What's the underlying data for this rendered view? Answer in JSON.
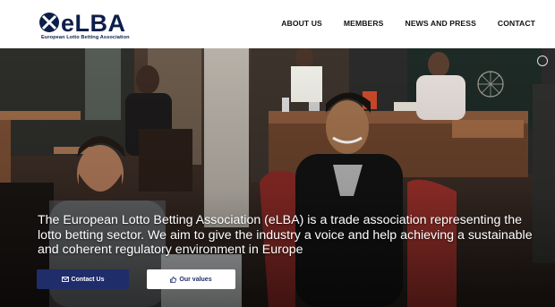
{
  "logo": {
    "name": "eLBA",
    "tagline": "European Lotto Betting Association"
  },
  "nav": {
    "items": [
      "ABOUT US",
      "MEMBERS",
      "NEWS AND PRESS",
      "CONTACT"
    ]
  },
  "hero": {
    "text": "The European Lotto Betting Association (eLBA) is a trade association representing the lotto betting sector. We aim to give the industry a voice and help achieving a sustainable and coherent regulatory environment in Europe",
    "buttons": {
      "contact_label": "Contact Us",
      "contact_icon": "envelope-icon",
      "values_label": "Our values",
      "values_icon": "thumbs-up-icon"
    }
  },
  "colors": {
    "brand_navy": "#0d1e4a",
    "button_navy": "#1f2d6b",
    "white": "#ffffff"
  }
}
